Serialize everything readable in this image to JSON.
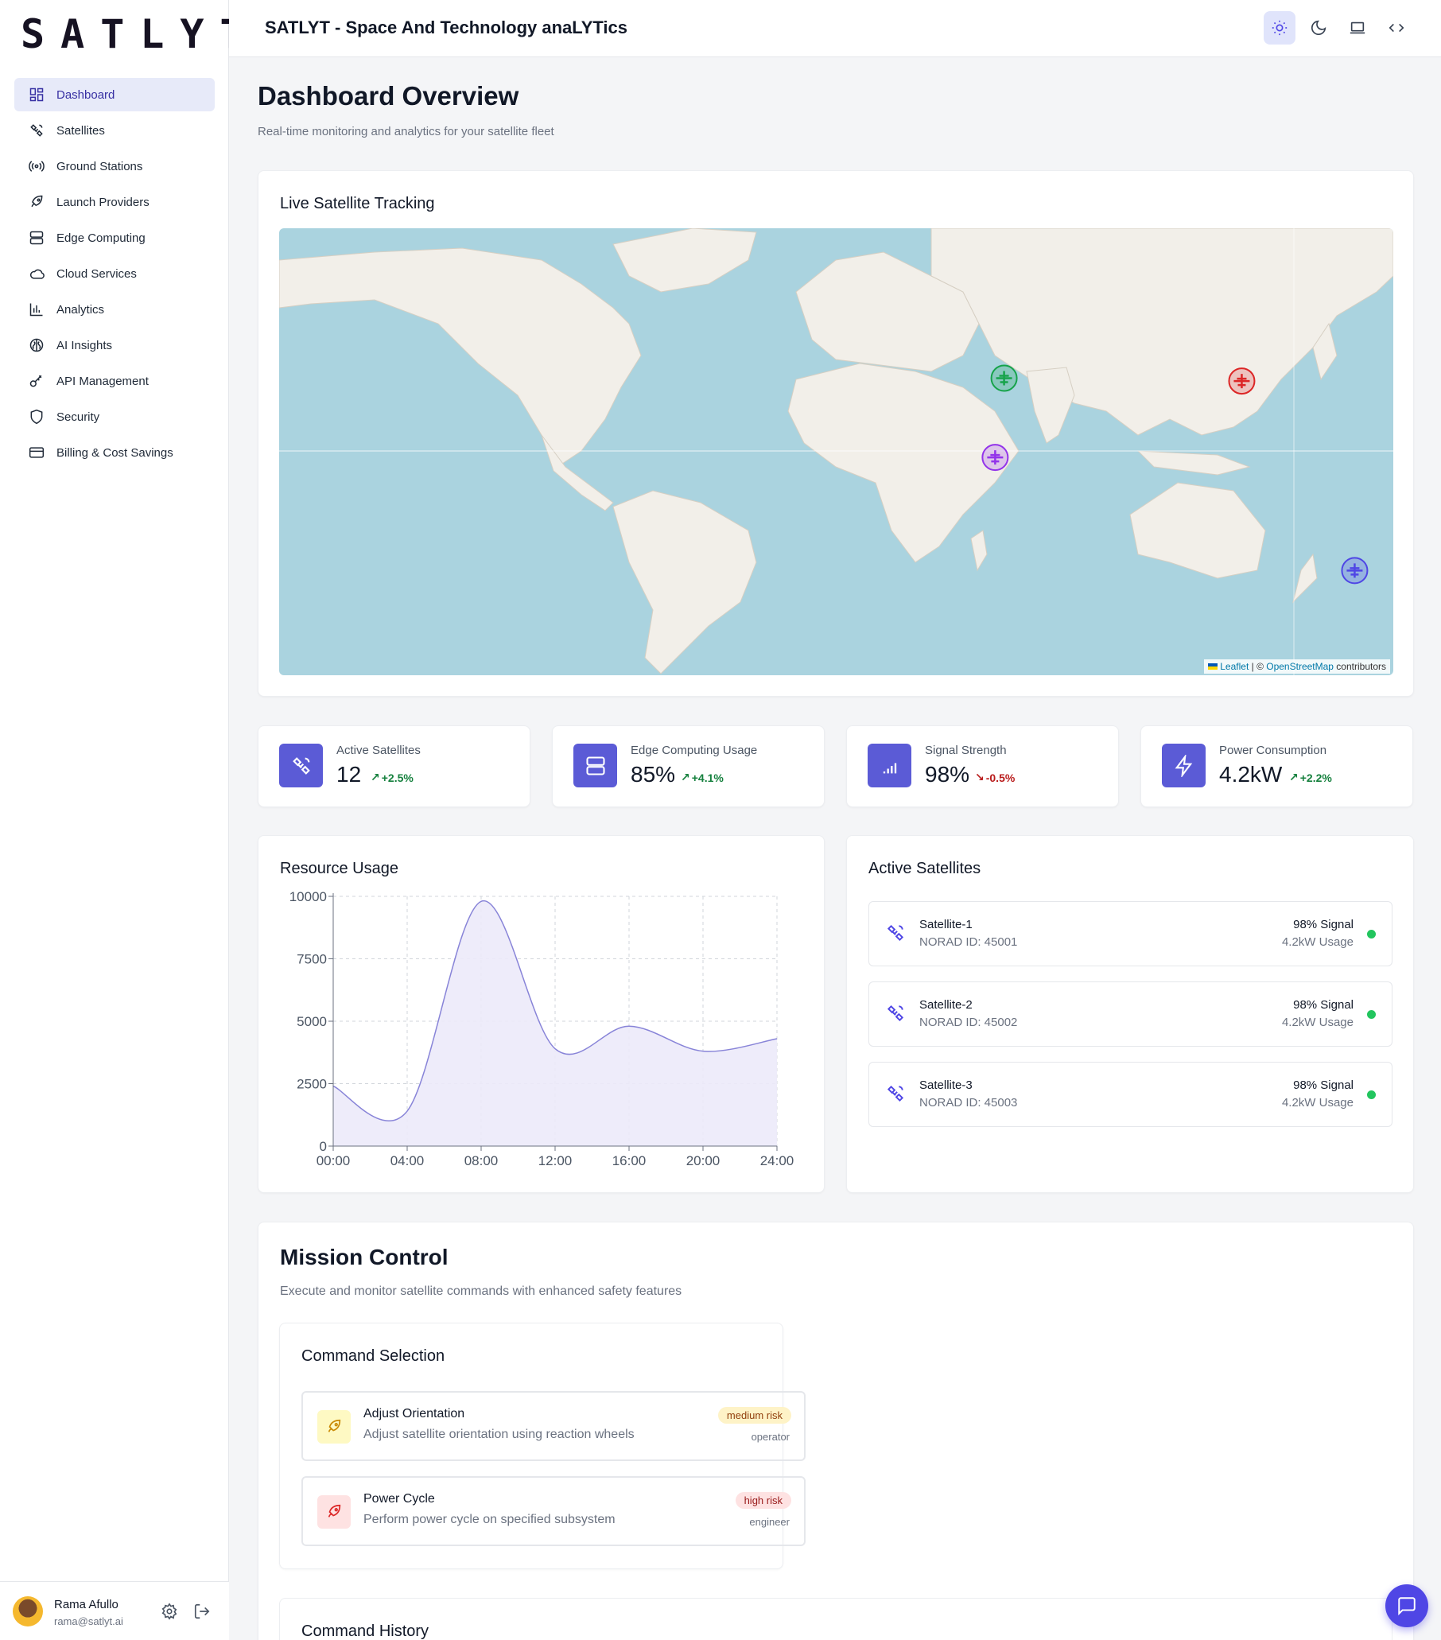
{
  "logo": "SATLYT",
  "header": {
    "title": "SATLYT - Space And Technology anaLYTics"
  },
  "sidebar": {
    "items": [
      {
        "label": "Dashboard",
        "icon": "dashboard-icon",
        "active": true
      },
      {
        "label": "Satellites",
        "icon": "satellite-icon"
      },
      {
        "label": "Ground Stations",
        "icon": "radio-tower-icon"
      },
      {
        "label": "Launch Providers",
        "icon": "rocket-icon"
      },
      {
        "label": "Edge Computing",
        "icon": "server-icon"
      },
      {
        "label": "Cloud Services",
        "icon": "cloud-icon"
      },
      {
        "label": "Analytics",
        "icon": "bar-chart-icon"
      },
      {
        "label": "AI Insights",
        "icon": "brain-icon"
      },
      {
        "label": "API Management",
        "icon": "key-icon"
      },
      {
        "label": "Security",
        "icon": "shield-icon"
      },
      {
        "label": "Billing & Cost Savings",
        "icon": "credit-card-icon"
      }
    ]
  },
  "user": {
    "name": "Rama Afullo",
    "email": "rama@satlyt.ai"
  },
  "page": {
    "title": "Dashboard Overview",
    "subtitle": "Real-time monitoring and analytics for your satellite fleet"
  },
  "map": {
    "title": "Live Satellite Tracking",
    "attribution": {
      "leaflet": "Leaflet",
      "sep": " | © ",
      "osm": "OpenStreetMap",
      "suffix": " contributors"
    },
    "markers": [
      {
        "color": "#16a34a",
        "lat": 27,
        "lon": 64
      },
      {
        "color": "#dc2626",
        "lat": 26,
        "lon": 144
      },
      {
        "color": "#9333ea",
        "lat": -1,
        "lon": 61
      },
      {
        "color": "#4f46e5",
        "lat": -41,
        "lon": 182
      }
    ]
  },
  "stats": [
    {
      "label": "Active Satellites",
      "value": "12",
      "delta": "+2.5%",
      "dir": "up",
      "icon": "satellite-icon"
    },
    {
      "label": "Edge Computing Usage",
      "value": "85%",
      "delta": "+4.1%",
      "dir": "up",
      "icon": "server-icon"
    },
    {
      "label": "Signal Strength",
      "value": "98%",
      "delta": "-0.5%",
      "dir": "down",
      "icon": "signal-icon"
    },
    {
      "label": "Power Consumption",
      "value": "4.2kW",
      "delta": "+2.2%",
      "dir": "up",
      "icon": "zap-icon"
    }
  ],
  "resource": {
    "title": "Resource Usage"
  },
  "chart_data": {
    "type": "area",
    "title": "Resource Usage",
    "x": [
      "00:00",
      "04:00",
      "08:00",
      "12:00",
      "16:00",
      "20:00",
      "24:00"
    ],
    "values": [
      2400,
      1400,
      9800,
      3900,
      4800,
      3800,
      4300
    ],
    "yticks": [
      0,
      2500,
      5000,
      7500,
      10000
    ],
    "ylim": [
      0,
      10000
    ],
    "grid": true,
    "colors": {
      "line": "#8884d8",
      "fill": "#eceafa"
    }
  },
  "satellites": {
    "title": "Active Satellites",
    "items": [
      {
        "name": "Satellite-1",
        "norad": "NORAD ID: 45001",
        "signal": "98% Signal",
        "usage": "4.2kW Usage"
      },
      {
        "name": "Satellite-2",
        "norad": "NORAD ID: 45002",
        "signal": "98% Signal",
        "usage": "4.2kW Usage"
      },
      {
        "name": "Satellite-3",
        "norad": "NORAD ID: 45003",
        "signal": "98% Signal",
        "usage": "4.2kW Usage"
      }
    ]
  },
  "mission": {
    "title": "Mission Control",
    "subtitle": "Execute and monitor satellite commands with enhanced safety features",
    "selection_title": "Command Selection",
    "commands": [
      {
        "name": "Adjust Orientation",
        "desc": "Adjust satellite orientation using reaction wheels",
        "risk": "medium risk",
        "role": "operator",
        "risk_bg": "#fef3c7",
        "risk_fg": "#92400e",
        "icon_bg": "#fef9c3",
        "icon_fg": "#ca8a04"
      },
      {
        "name": "Power Cycle",
        "desc": "Perform power cycle on specified subsystem",
        "risk": "high risk",
        "role": "engineer",
        "risk_bg": "#fee2e2",
        "risk_fg": "#991b1b",
        "icon_bg": "#fee2e2",
        "icon_fg": "#dc2626"
      }
    ],
    "history_title": "Command History"
  },
  "colors": {
    "accent": "#5b5bd6",
    "active_nav": "#e7eaf9"
  }
}
